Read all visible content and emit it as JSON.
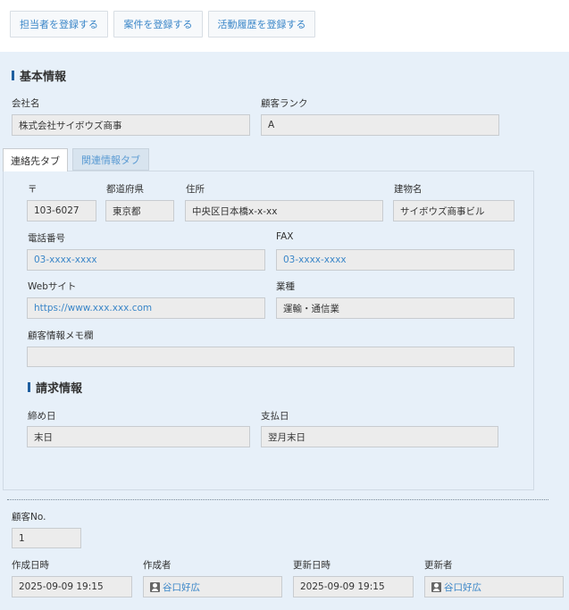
{
  "toolbar": {
    "btn_register_staff": "担当者を登録する",
    "btn_register_deal": "案件を登録する",
    "btn_register_activity": "活動履歴を登録する"
  },
  "basic": {
    "heading": "基本情報",
    "company_label": "会社名",
    "company_value": "株式会社サイボウズ商事",
    "rank_label": "顧客ランク",
    "rank_value": "A"
  },
  "tabs": {
    "contact": "連絡先タブ",
    "related": "関連情報タブ"
  },
  "contact": {
    "postal_label": "〒",
    "postal_value": "103-6027",
    "pref_label": "都道府県",
    "pref_value": "東京都",
    "address_label": "住所",
    "address_value": "中央区日本橋x-x-xx",
    "building_label": "建物名",
    "building_value": "サイボウズ商事ビル",
    "phone_label": "電話番号",
    "phone_value": "03-xxxx-xxxx",
    "fax_label": "FAX",
    "fax_value": "03-xxxx-xxxx",
    "web_label": "Webサイト",
    "web_value": "https://www.xxx.xxx.com",
    "industry_label": "業種",
    "industry_value": "運輸・通信業",
    "memo_label": "顧客情報メモ欄",
    "memo_value": ""
  },
  "billing": {
    "heading": "請求情報",
    "closing_label": "締め日",
    "closing_value": "末日",
    "payment_label": "支払日",
    "payment_value": "翌月末日"
  },
  "meta": {
    "customer_no_label": "顧客No.",
    "customer_no_value": "1",
    "created_at_label": "作成日時",
    "created_at_value": "2025-09-09 19:15",
    "creator_label": "作成者",
    "creator_value": "谷口好広",
    "updated_at_label": "更新日時",
    "updated_at_value": "2025-09-09 19:15",
    "updater_label": "更新者",
    "updater_value": "谷口好広"
  }
}
